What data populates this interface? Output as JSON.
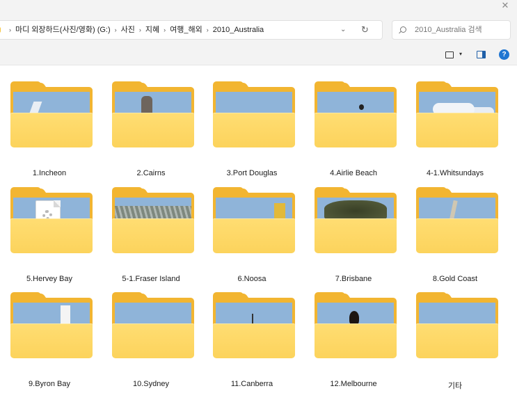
{
  "window": {
    "close_glyph": "✕"
  },
  "address_bar": {
    "breadcrumbs": [
      "마디 외장하드(사진/영화) (G:)",
      "사진",
      "지혜",
      "여행_해외",
      "2010_Australia"
    ],
    "separator": "›",
    "dropdown_glyph": "⌄",
    "refresh_glyph": "↻"
  },
  "search": {
    "placeholder": "2010_Australia 검색"
  },
  "command_bar": {
    "view_chevron": "▾",
    "help_glyph": "?"
  },
  "folders": [
    {
      "name": "1.Incheon",
      "thumb": "p-incheon"
    },
    {
      "name": "2.Cairns",
      "thumb": "p-cairns"
    },
    {
      "name": "3.Port Douglas",
      "thumb": "p-portdouglas"
    },
    {
      "name": "4.Airlie Beach",
      "thumb": "p-airlie"
    },
    {
      "name": "4-1.Whitsundays",
      "thumb": "p-whitsundays"
    },
    {
      "name": "5.Hervey Bay",
      "thumb": "p-hervey"
    },
    {
      "name": "5-1.Fraser Island",
      "thumb": "p-fraser"
    },
    {
      "name": "6.Noosa",
      "thumb": "p-noosa"
    },
    {
      "name": "7.Brisbane",
      "thumb": "p-brisbane"
    },
    {
      "name": "8.Gold Coast",
      "thumb": "p-goldcoast"
    },
    {
      "name": "9.Byron Bay",
      "thumb": "p-byron"
    },
    {
      "name": "10.Sydney",
      "thumb": "p-sydney"
    },
    {
      "name": "11.Canberra",
      "thumb": "p-canberra"
    },
    {
      "name": "12.Melbourne",
      "thumb": "p-melbourne"
    },
    {
      "name": "기타",
      "thumb": "p-etc"
    }
  ],
  "colors": {
    "folder_back": "#f2b531",
    "folder_front": "#fcd35c",
    "accent": "#1f76d2"
  }
}
